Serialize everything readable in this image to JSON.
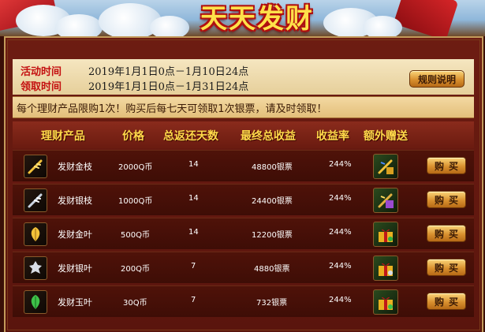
{
  "banner": {
    "title": "天天发财"
  },
  "info": {
    "activity_label": "活动时间",
    "activity_time": "2019年1月1日0点－1月10日24点",
    "claim_label": "领取时间",
    "claim_time": "2019年1月1日0点－1月31日24点",
    "rules_button": "规则说明"
  },
  "notice": "每个理财产品限购1次！购买后每七天可领取1次银票，请及时领取！",
  "table": {
    "headers": [
      "理财产品",
      "价格",
      "总返还天数",
      "最终总收益",
      "收益率",
      "额外赠送"
    ],
    "rows": [
      {
        "name": "发财金枝",
        "price": "2000Q币",
        "days": "14",
        "total": "48800银票",
        "rate": "244%",
        "buy": "购买",
        "icon": "gold-branch-icon",
        "gift_icon": "gold-gift-icon"
      },
      {
        "name": "发财银枝",
        "price": "1000Q币",
        "days": "14",
        "total": "24400银票",
        "rate": "244%",
        "buy": "购买",
        "icon": "silver-branch-icon",
        "gift_icon": "purple-gift-icon"
      },
      {
        "name": "发财金叶",
        "price": "500Q币",
        "days": "14",
        "total": "12200银票",
        "rate": "244%",
        "buy": "购买",
        "icon": "gold-leaf-icon",
        "gift_icon": "green-gift-icon"
      },
      {
        "name": "发财银叶",
        "price": "200Q币",
        "days": "7",
        "total": "4880银票",
        "rate": "244%",
        "buy": "购买",
        "icon": "silver-leaf-icon",
        "gift_icon": "green-gift-icon"
      },
      {
        "name": "发财玉叶",
        "price": "30Q币",
        "days": "7",
        "total": "732银票",
        "rate": "244%",
        "buy": "购买",
        "icon": "jade-leaf-icon",
        "gift_icon": "green-gift-icon"
      }
    ]
  },
  "colors": {
    "accent": "#ffd94a",
    "label_red": "#c41010",
    "frame_gold": "#c39a5a"
  }
}
